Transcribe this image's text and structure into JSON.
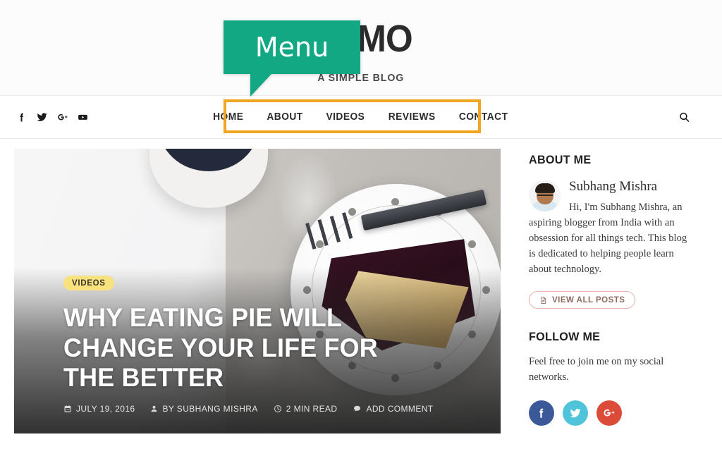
{
  "header": {
    "title": "DEMO",
    "tagline": "A SIMPLE BLOG"
  },
  "callout": {
    "label": "Menu",
    "color": "#13a884"
  },
  "nav": {
    "highlight_color": "#f0a621",
    "items": [
      {
        "label": "HOME"
      },
      {
        "label": "ABOUT"
      },
      {
        "label": "VIDEOS"
      },
      {
        "label": "REVIEWS"
      },
      {
        "label": "CONTACT"
      }
    ],
    "search_icon": "search-icon",
    "social": [
      {
        "name": "facebook-icon"
      },
      {
        "name": "twitter-icon"
      },
      {
        "name": "google-plus-icon"
      },
      {
        "name": "youtube-icon"
      }
    ]
  },
  "hero": {
    "category_badge": "VIDEOS",
    "badge_color": "#f7e27e",
    "title": "WHY EATING PIE WILL CHANGE YOUR LIFE FOR THE BETTER",
    "meta": {
      "date": "JULY 19, 2016",
      "author": "BY SUBHANG MISHRA",
      "read_time": "2 MIN READ",
      "comments": "ADD COMMENT"
    }
  },
  "sidebar": {
    "about": {
      "title": "ABOUT ME",
      "author_name": "Subhang Mishra",
      "bio": "Hi, I'm Subhang Mishra, an aspiring blogger from India with an obsession for all things tech. This blog is dedicated to helping people learn about technology.",
      "button_label": "VIEW ALL POSTS"
    },
    "follow": {
      "title": "FOLLOW ME",
      "text": "Feel free to join me on my social networks.",
      "links": [
        {
          "name": "facebook-circle",
          "color": "#3b5998"
        },
        {
          "name": "twitter-circle",
          "color": "#4ec3da"
        },
        {
          "name": "google-plus-circle",
          "color": "#dc4a38"
        }
      ]
    }
  }
}
